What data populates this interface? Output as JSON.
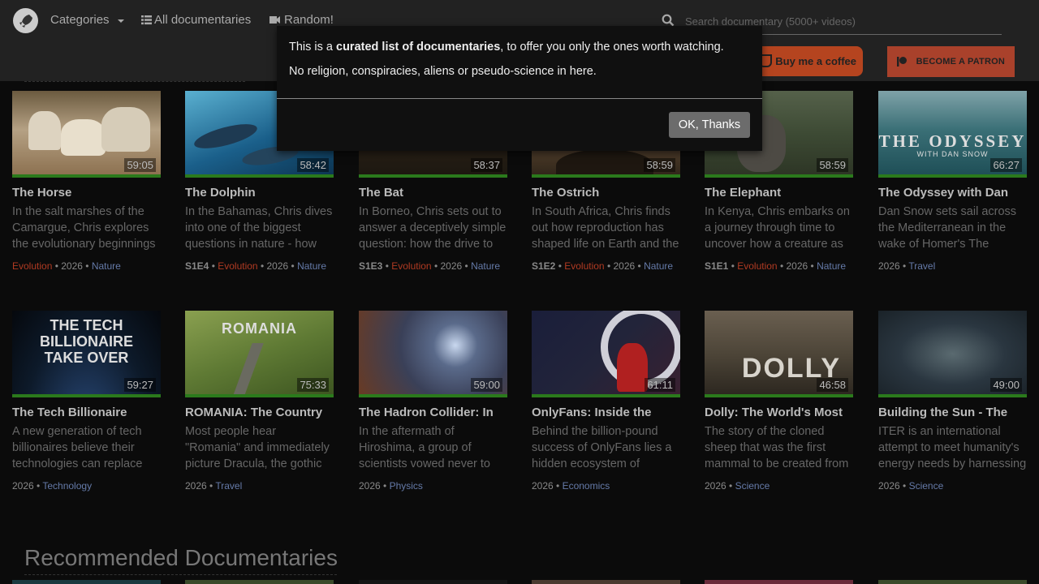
{
  "nav": {
    "categories": "Categories",
    "all_docs": "All documentaries",
    "random": "Random!",
    "search_placeholder": "Search documentary (5000+ videos)",
    "coffee": "Buy me a coffee",
    "patron": "BECOME A PATRON"
  },
  "modal": {
    "line1_pre": "This is a ",
    "line1_bold": "curated list of documentaries",
    "line1_post": ", to offer you only the ones worth watching.",
    "line2": "No religion, conspiracies, aliens or pseudo-science in here.",
    "ok": "OK, Thanks"
  },
  "row1": [
    {
      "title": "The Horse",
      "duration": "59:05",
      "desc": "In the salt marshes of the Camargue, Chris explores the evolutionary beginnings",
      "episode": "",
      "tag": "Evolution",
      "year": "2026",
      "category": "Nature",
      "thumb_bg": "#b5a184"
    },
    {
      "title": "The Dolphin",
      "duration": "58:42",
      "desc": "In the Bahamas, Chris dives into one of the biggest questions in nature - how",
      "episode": "S1E4",
      "tag": "Evolution",
      "year": "2026",
      "category": "Nature",
      "thumb_bg": "#1a5f8a"
    },
    {
      "title": "The Bat",
      "duration": "58:37",
      "desc": "In Borneo, Chris sets out to answer a deceptively simple question: how the drive to",
      "episode": "S1E3",
      "tag": "Evolution",
      "year": "2026",
      "category": "Nature",
      "thumb_bg": "#2a2218"
    },
    {
      "title": "The Ostrich",
      "duration": "58:59",
      "desc": "In South Africa, Chris finds out how reproduction has shaped life on Earth and the",
      "episode": "S1E2",
      "tag": "Evolution",
      "year": "2026",
      "category": "Nature",
      "thumb_bg": "#5a4632"
    },
    {
      "title": "The Elephant",
      "duration": "58:59",
      "desc": "In Kenya, Chris embarks on a journey through time to uncover how a creature as",
      "episode": "S1E1",
      "tag": "Evolution",
      "year": "2026",
      "category": "Nature",
      "thumb_bg": "#3d4a34"
    },
    {
      "title": "The Odyssey with Dan",
      "duration": "66:27",
      "desc": "Dan Snow sets sail across the Mediterranean in the wake of Homer's The",
      "episode": "",
      "tag": "",
      "year": "2026",
      "category": "Travel",
      "thumb_bg": "#3a6f76",
      "overlay": "THE ODYSSEY",
      "overlay_sub": "WITH DAN SNOW"
    }
  ],
  "row2": [
    {
      "title": "The Tech Billionaire",
      "duration": "59:27",
      "desc": "A new generation of tech billionaires believe their technologies can replace",
      "year": "2026",
      "category": "Technology",
      "thumb_bg": "#0d1a2a",
      "overlay": "THE TECH BILLIONAIRE TAKE OVER"
    },
    {
      "title": "ROMANIA: The Country",
      "duration": "75:33",
      "desc": "Most people hear \"Romania\" and immediately picture Dracula, the gothic myths of",
      "year": "2026",
      "category": "Travel",
      "thumb_bg": "#5f7a34",
      "overlay": "ROMANIA"
    },
    {
      "title": "The Hadron Collider: In",
      "duration": "59:00",
      "desc": "In the aftermath of Hiroshima, a group of scientists vowed never to",
      "year": "2026",
      "category": "Physics",
      "thumb_bg": "#3a4058"
    },
    {
      "title": "OnlyFans: Inside the",
      "duration": "61:11",
      "desc": "Behind the billion-pound success of OnlyFans lies a hidden ecosystem of",
      "year": "2026",
      "category": "Economics",
      "thumb_bg": "#22243a"
    },
    {
      "title": "Dolly: The World's Most",
      "duration": "46:58",
      "desc": "The story of the cloned sheep that was the first mammal to be created from",
      "year": "2026",
      "category": "Science",
      "thumb_bg": "#4d4538",
      "overlay": "DOLLY"
    },
    {
      "title": "Building the Sun - The",
      "duration": "49:00",
      "desc": "ITER is an international attempt to meet humanity's energy needs by harnessing",
      "year": "2026",
      "category": "Science",
      "thumb_bg": "#2a3640"
    }
  ],
  "section_heading": "Recommended Documentaries"
}
